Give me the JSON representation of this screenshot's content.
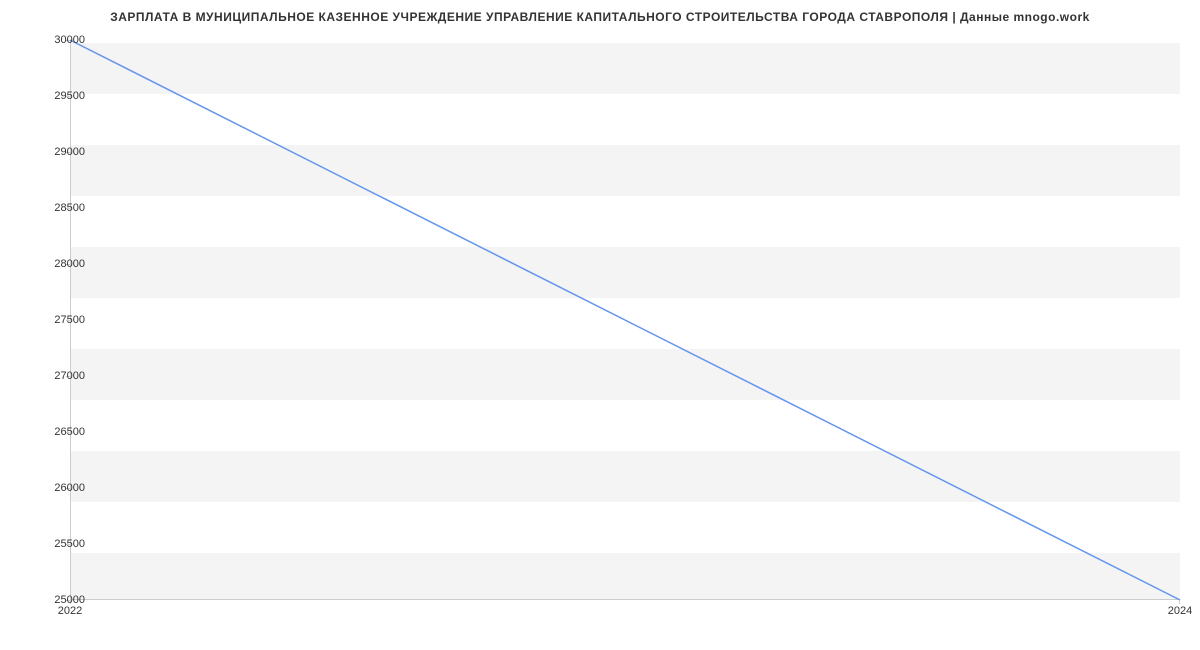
{
  "chart_data": {
    "type": "line",
    "title": "ЗАРПЛАТА В МУНИЦИПАЛЬНОЕ КАЗЕННОЕ УЧРЕЖДЕНИЕ УПРАВЛЕНИЕ КАПИТАЛЬНОГО СТРОИТЕЛЬСТВА ГОРОДА СТАВРОПОЛЯ | Данные mnogo.work",
    "x": [
      2022,
      2024
    ],
    "values": [
      30000,
      25000
    ],
    "xticks": [
      "2022",
      "2024"
    ],
    "yticks": [
      "25000",
      "25500",
      "26000",
      "26500",
      "27000",
      "27500",
      "28000",
      "28500",
      "29000",
      "29500",
      "30000"
    ],
    "xlim": [
      2022,
      2024
    ],
    "ylim": [
      25000,
      30000
    ],
    "line_color": "#6495ed"
  }
}
